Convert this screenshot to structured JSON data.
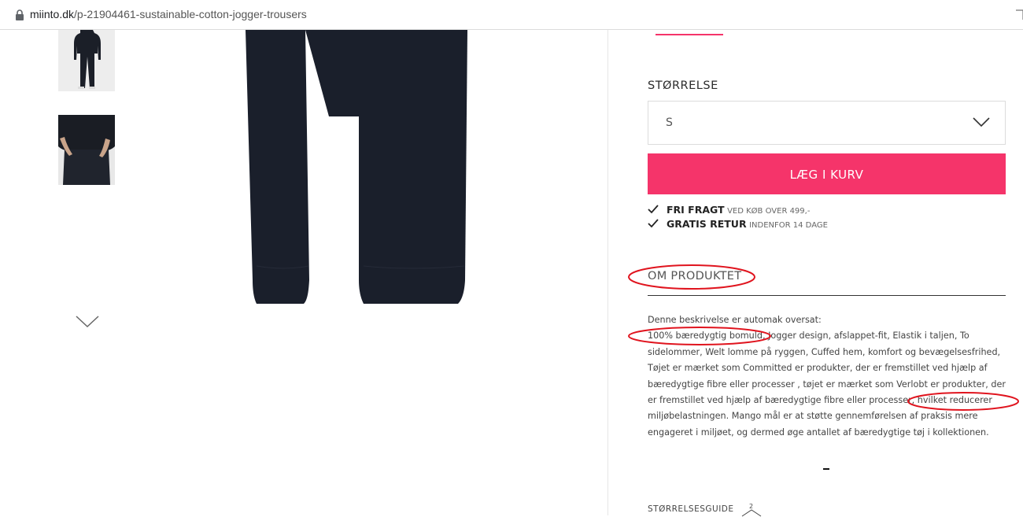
{
  "browser": {
    "url_domain": "miinto.dk",
    "url_path": "/p-21904461-sustainable-cotton-jogger-trousers"
  },
  "product": {
    "size_label": "STØRRELSE",
    "selected_size": "S",
    "add_to_cart_label": "LÆG I KURV",
    "usp": [
      {
        "bold": "FRI FRAGT",
        "small": "VED KØB OVER 499,-"
      },
      {
        "bold": "GRATIS RETUR",
        "small": "INDENFOR 14 DAGE"
      }
    ],
    "about_title": "OM PRODUKTET",
    "description": {
      "line1": "Denne beskrivelse er automak oversat:",
      "body": "100% bæredygtig bomuld, Jogger design, afslappet-fit, Elastik i taljen, To sidelommer, Welt lomme på ryggen, Cuffed hem, komfort og bevægelsesfrihed, Tøjet er mærket som Committed er produkter, der er fremstillet ved hjælp af bæredygtige fibre eller processer , tøjet er mærket som Verlobt er produkter, der er fremstillet ved hjælp af bæredygtige fibre eller processer, hvilket reducerer miljøbelastningen. Mango mål er at støtte gennemførelsen af praksis mere engageret i miljøet, og dermed øge antallet af bæredygtige tøj i kollektionen."
    },
    "size_guide_label": "STØRRELSESGUIDE",
    "hanger_badge": "2"
  },
  "colors": {
    "accent": "#f5346a",
    "annotation": "#e0141e",
    "product": "#1a1f2b"
  },
  "icons": [
    "lock-icon",
    "chevron-down-icon",
    "check-icon",
    "hanger-icon"
  ]
}
